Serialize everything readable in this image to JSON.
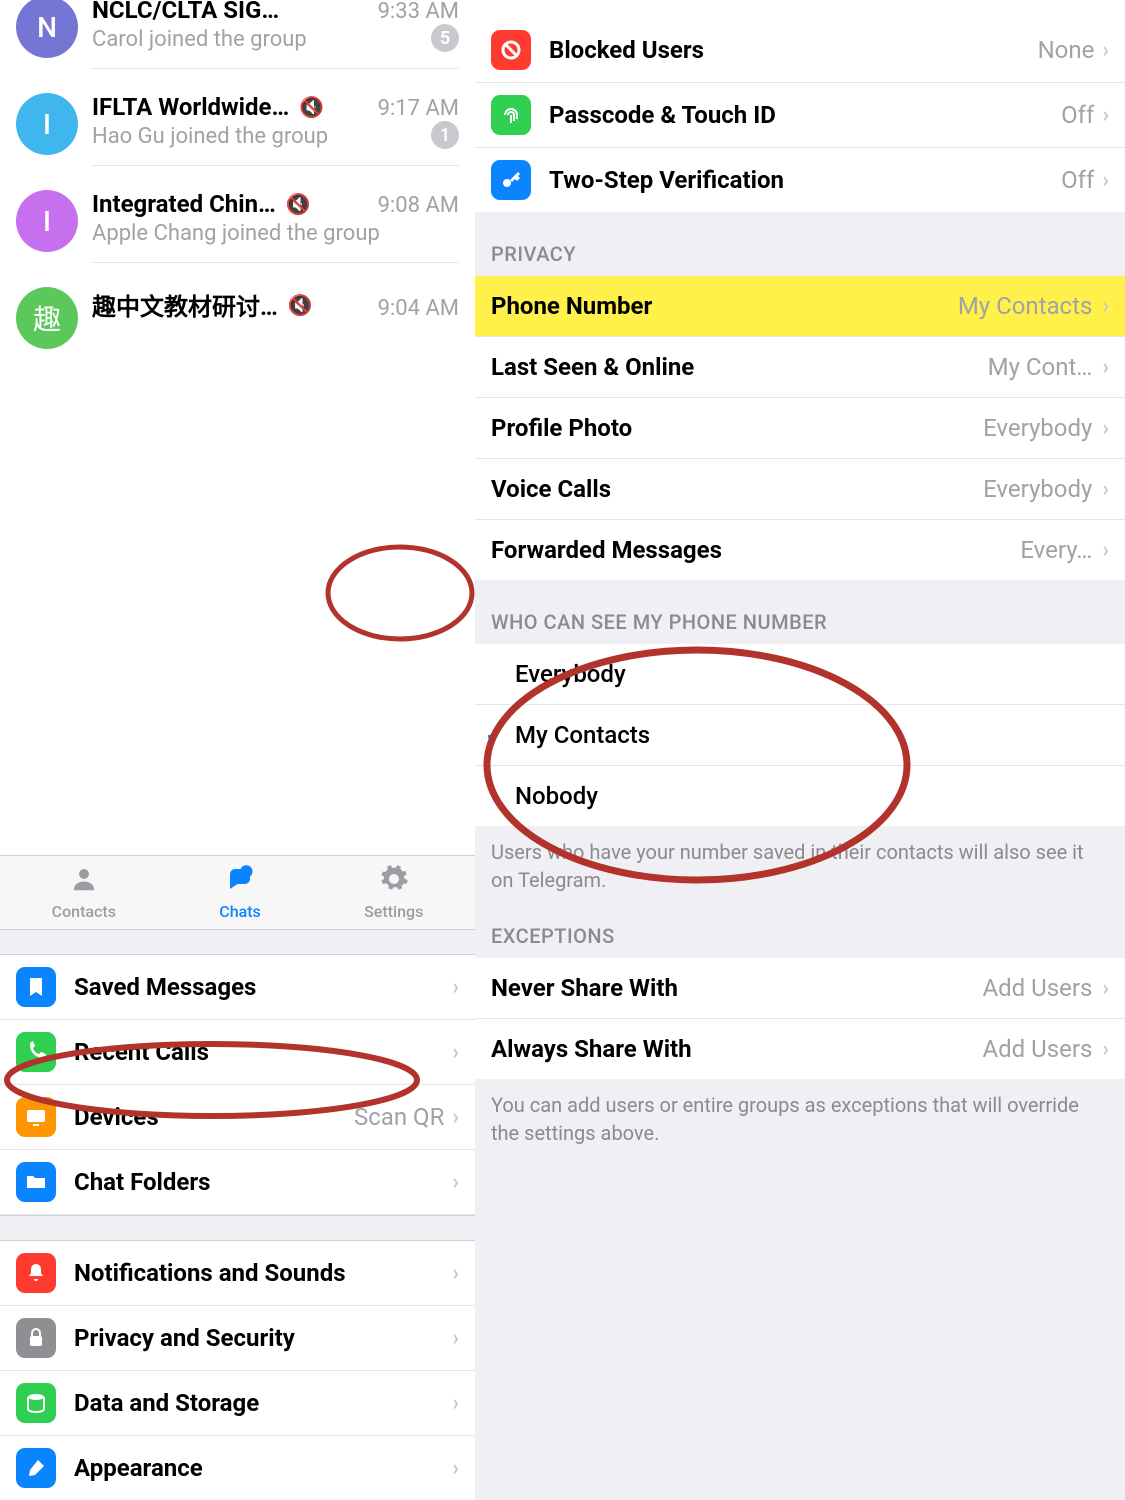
{
  "left": {
    "chats": [
      {
        "avatar_letter": "N",
        "avatar_color": "#7575d6",
        "title": "NCLC/CLTA SIG…",
        "muted": false,
        "time": "9:33 AM",
        "subtitle": "Carol joined the group",
        "badge": "5"
      },
      {
        "avatar_letter": "I",
        "avatar_color": "#3fb6ed",
        "title": "IFLTA Worldwide…",
        "muted": true,
        "time": "9:17 AM",
        "subtitle": "Hao Gu joined the group",
        "badge": "1"
      },
      {
        "avatar_letter": "I",
        "avatar_color": "#c66fef",
        "title": "Integrated Chin…",
        "muted": true,
        "time": "9:08 AM",
        "subtitle": "Apple Chang joined the group",
        "badge": null
      },
      {
        "avatar_letter": "趣",
        "avatar_color": "#5cc85c",
        "title": "趣中文教材研讨…",
        "muted": true,
        "time": "9:04 AM",
        "subtitle": "",
        "badge": null
      }
    ],
    "tabs": {
      "contacts": "Contacts",
      "chats": "Chats",
      "settings": "Settings"
    },
    "settings_rows": [
      {
        "icon": "bookmark",
        "bg": "#0a84ff",
        "label": "Saved Messages",
        "value": ""
      },
      {
        "icon": "phone",
        "bg": "#2fcf52",
        "label": "Recent Calls",
        "value": ""
      },
      {
        "icon": "monitor",
        "bg": "#ff9500",
        "label": "Devices",
        "value": "Scan QR"
      },
      {
        "icon": "folder",
        "bg": "#0a84ff",
        "label": "Chat Folders",
        "value": ""
      },
      {
        "icon": "bell",
        "bg": "#ff3b30",
        "label": "Notifications and Sounds",
        "value": ""
      },
      {
        "icon": "lock",
        "bg": "#8e8e93",
        "label": "Privacy and Security",
        "value": ""
      },
      {
        "icon": "disk",
        "bg": "#2fcf52",
        "label": "Data and Storage",
        "value": ""
      },
      {
        "icon": "brush",
        "bg": "#0a84ff",
        "label": "Appearance",
        "value": ""
      }
    ]
  },
  "right": {
    "top_rows": [
      {
        "icon": "block",
        "bg": "#ff3b30",
        "label": "Blocked Users",
        "value": "None"
      },
      {
        "icon": "touch",
        "bg": "#2fcf52",
        "label": "Passcode & Touch ID",
        "value": "Off"
      },
      {
        "icon": "key",
        "bg": "#0a84ff",
        "label": "Two-Step Verification",
        "value": "Off"
      }
    ],
    "privacy_header": "PRIVACY",
    "privacy_rows": [
      {
        "label": "Phone Number",
        "value": "My Contacts",
        "highlight": true
      },
      {
        "label": "Last Seen & Online",
        "value": "My Cont…"
      },
      {
        "label": "Profile Photo",
        "value": "Everybody"
      },
      {
        "label": "Voice Calls",
        "value": "Everybody"
      },
      {
        "label": "Forwarded Messages",
        "value": "Every…"
      }
    ],
    "who_header": "WHO CAN SEE MY PHONE NUMBER",
    "who_options": [
      {
        "label": "Everybody",
        "checked": false
      },
      {
        "label": "My Contacts",
        "checked": true
      },
      {
        "label": "Nobody",
        "checked": false
      }
    ],
    "who_footer": "Users who have your number saved in their contacts will also see it on Telegram.",
    "exc_header": "EXCEPTIONS",
    "exc_rows": [
      {
        "label": "Never Share With",
        "value": "Add Users"
      },
      {
        "label": "Always Share With",
        "value": "Add Users"
      }
    ],
    "exc_footer": "You can add users or entire groups as exceptions that will override the settings above."
  }
}
